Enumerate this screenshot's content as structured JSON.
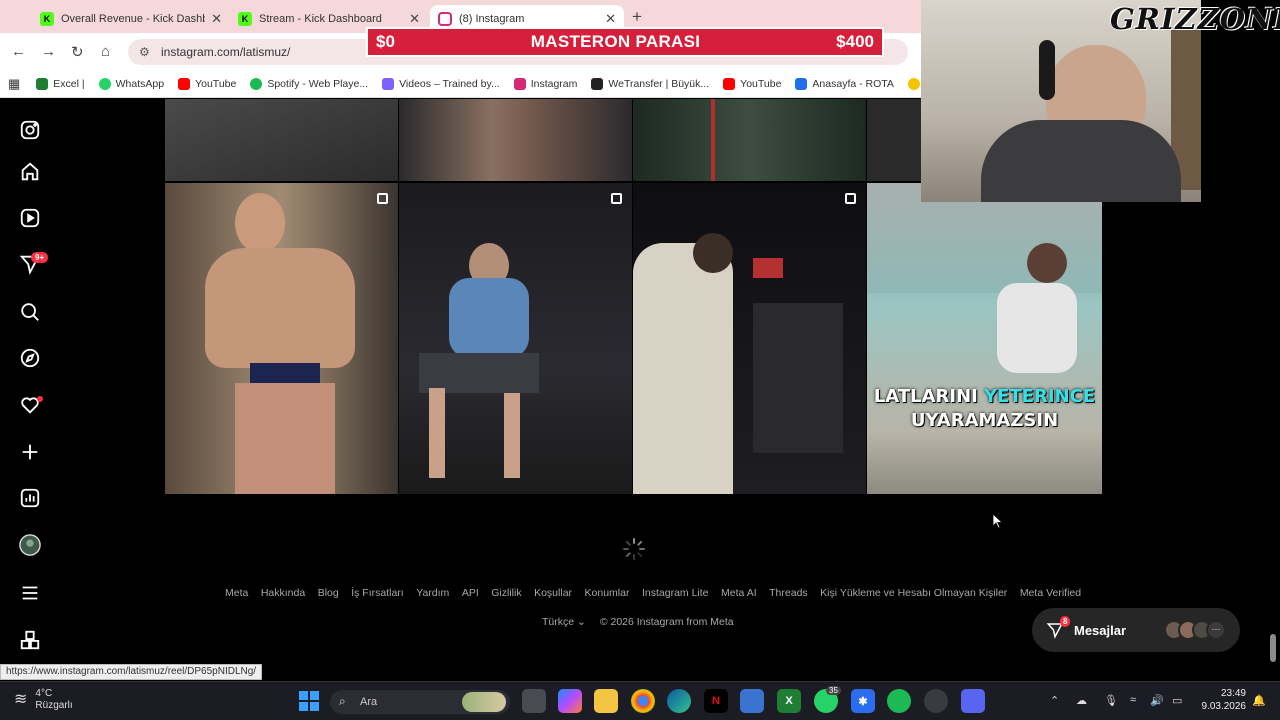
{
  "browser": {
    "tabs": [
      {
        "title": "Overall Revenue - Kick Dashbo",
        "icon": "kick-icon",
        "color": "#53fc18"
      },
      {
        "title": "Stream - Kick Dashboard",
        "icon": "kick-icon",
        "color": "#53fc18"
      },
      {
        "title": "(8) Instagram",
        "icon": "instagram-icon",
        "color": "#d62976"
      }
    ],
    "url": "instagram.com/latismuz/",
    "bookmarks": [
      {
        "label": "Excel |",
        "color": "#1e7e34"
      },
      {
        "label": "WhatsApp",
        "color": "#25d366"
      },
      {
        "label": "YouTube",
        "color": "#ff0000"
      },
      {
        "label": "Spotify - Web Playe...",
        "color": "#1db954"
      },
      {
        "label": "Videos – Trained by...",
        "color": "#7b61ff"
      },
      {
        "label": "Instagram",
        "color": "#d62976"
      },
      {
        "label": "WeTransfer | Büyük...",
        "color": "#222222"
      },
      {
        "label": "YouTube",
        "color": "#ff0000"
      },
      {
        "label": "Anasayfa - ROTA",
        "color": "#1f6feb"
      },
      {
        "label": "K",
        "color": "#f5c400"
      }
    ],
    "status_url": "https://www.instagram.com/latismuz/reel/DP65pNIDLNg/"
  },
  "banner": {
    "left": "$0",
    "center": "MASTERON PARASI",
    "right": "$400",
    "color": "#d6203b"
  },
  "sidebar": {
    "icons": [
      "instagram-logo-icon",
      "home-icon",
      "reels-icon",
      "messages-icon",
      "search-icon",
      "explore-icon",
      "notifications-icon",
      "create-icon",
      "dashboard-icon",
      "profile-avatar-icon",
      "menu-icon",
      "more-icon"
    ],
    "messages_badge": "9+"
  },
  "grid": {
    "caption_plain": "LATLARINI",
    "caption_highlight": "YETERINCE",
    "caption_line2": "UYARAMAZSIN"
  },
  "footer": {
    "links": [
      "Meta",
      "Hakkında",
      "Blog",
      "İş Fırsatları",
      "Yardım",
      "API",
      "Gizlilik",
      "Koşullar",
      "Konumlar",
      "Instagram Lite",
      "Meta AI",
      "Threads",
      "Kişi Yükleme ve Hesabı Olmayan Kişiler",
      "Meta Verified"
    ],
    "language": "Türkçe",
    "copyright": "© 2026 Instagram from Meta"
  },
  "messages_pill": {
    "label": "Mesajlar",
    "count": "8"
  },
  "overlay": {
    "streamer_logo": "GRIZZONE"
  },
  "taskbar": {
    "weather_temp": "4°C",
    "weather_desc": "Rüzgarlı",
    "search_placeholder": "Ara",
    "whatsapp_badge": "35",
    "time": "23:49",
    "date": "9.03.2026"
  }
}
